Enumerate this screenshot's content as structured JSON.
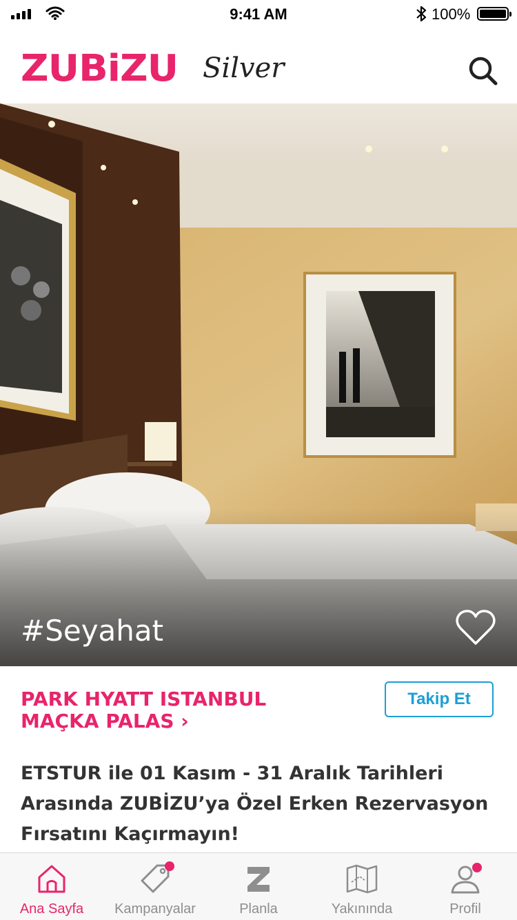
{
  "status_bar": {
    "time": "9:41 AM",
    "battery": "100%"
  },
  "header": {
    "logo": "ZUBiZU",
    "logo_sub": "Silver",
    "search_icon": "search-icon"
  },
  "hero": {
    "tag": "#Seyahat",
    "favorite_icon": "heart-icon"
  },
  "venue": {
    "name": "PARK HYATT ISTANBUL MAÇKA PALAS ›",
    "follow_label": "Takip Et"
  },
  "post": {
    "description": "ETSTUR ile 01 Kasım - 31 Aralık Tarihleri Arasında ZUBİZU’ya Özel Erken Rezervasyon Fırsatını Kaçırmayın!"
  },
  "tab_bar": {
    "items": [
      {
        "label": "Ana Sayfa",
        "icon": "home-icon",
        "active": true,
        "badge": false
      },
      {
        "label": "Kampanyalar",
        "icon": "tag-icon",
        "active": false,
        "badge": true
      },
      {
        "label": "Planla",
        "icon": "z-icon",
        "active": false,
        "badge": false
      },
      {
        "label": "Yakınında",
        "icon": "map-icon",
        "active": false,
        "badge": false
      },
      {
        "label": "Profil",
        "icon": "profile-icon",
        "active": false,
        "badge": true
      }
    ]
  },
  "colors": {
    "brand": "#e8246b",
    "follow": "#1a9fd6",
    "inactive": "#8e8e8e"
  }
}
